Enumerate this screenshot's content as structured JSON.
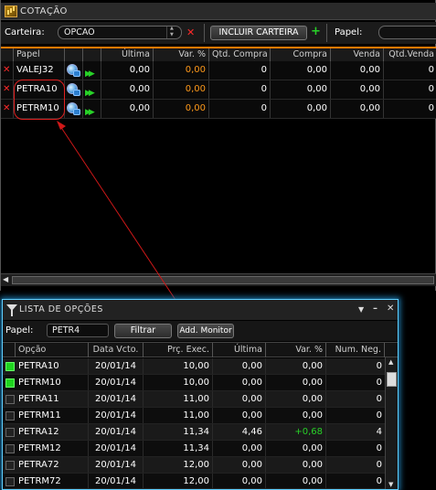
{
  "cotacao": {
    "title": "COTAÇÃO",
    "toolbar": {
      "carteira_label": "Carteira:",
      "carteira_value": "OPCAO",
      "incluir_label": "INCLUIR CARTEIRA",
      "papel_label": "Papel:",
      "papel_value": ""
    },
    "columns": [
      "Papel",
      "Última",
      "Var. %",
      "Qtd. Compra",
      "Compra",
      "Venda",
      "Qtd.Venda"
    ],
    "rows": [
      {
        "papel": "VALEJ32",
        "ultima": "0,00",
        "var": "0,00",
        "qtd_compra": "0",
        "compra": "0,00",
        "venda": "0,00",
        "qtd_venda": "0"
      },
      {
        "papel": "PETRA10",
        "ultima": "0,00",
        "var": "0,00",
        "qtd_compra": "0",
        "compra": "0,00",
        "venda": "0,00",
        "qtd_venda": "0"
      },
      {
        "papel": "PETRM10",
        "ultima": "0,00",
        "var": "0,00",
        "qtd_compra": "0",
        "compra": "0,00",
        "venda": "0,00",
        "qtd_venda": "0"
      }
    ]
  },
  "lista_opcoes": {
    "title": "LISTA DE OPÇÕES",
    "filter": {
      "papel_label": "Papel:",
      "papel_value": "PETR4",
      "filtrar_label": "Filtrar",
      "add_monitor_label": "Add. Monitor"
    },
    "columns": [
      "Opção",
      "Data Vcto.",
      "Prç. Exec.",
      "Última",
      "Var. %",
      "Num. Neg."
    ],
    "rows": [
      {
        "checked": true,
        "opcao": "PETRA10",
        "data": "20/01/14",
        "exec": "10,00",
        "ultima": "0,00",
        "var": "0,00",
        "neg": "0"
      },
      {
        "checked": true,
        "opcao": "PETRM10",
        "data": "20/01/14",
        "exec": "10,00",
        "ultima": "0,00",
        "var": "0,00",
        "neg": "0"
      },
      {
        "checked": false,
        "opcao": "PETRA11",
        "data": "20/01/14",
        "exec": "11,00",
        "ultima": "0,00",
        "var": "0,00",
        "neg": "0"
      },
      {
        "checked": false,
        "opcao": "PETRM11",
        "data": "20/01/14",
        "exec": "11,00",
        "ultima": "0,00",
        "var": "0,00",
        "neg": "0"
      },
      {
        "checked": false,
        "opcao": "PETRA12",
        "data": "20/01/14",
        "exec": "11,34",
        "ultima": "4,46",
        "var": "+0,68",
        "neg": "4"
      },
      {
        "checked": false,
        "opcao": "PETRM12",
        "data": "20/01/14",
        "exec": "11,34",
        "ultima": "0,00",
        "var": "0,00",
        "neg": "0"
      },
      {
        "checked": false,
        "opcao": "PETRA72",
        "data": "20/01/14",
        "exec": "12,00",
        "ultima": "0,00",
        "var": "0,00",
        "neg": "0"
      },
      {
        "checked": false,
        "opcao": "PETRM72",
        "data": "20/01/14",
        "exec": "12,00",
        "ultima": "0,00",
        "var": "0,00",
        "neg": "0"
      }
    ]
  },
  "colors": {
    "accent_orange": "#ff7a00",
    "positive_green": "#28d228",
    "remove_red": "#ff2a2a",
    "window_glow": "#5fd0ff"
  }
}
